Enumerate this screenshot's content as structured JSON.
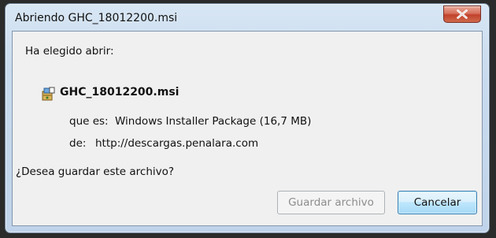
{
  "window": {
    "title": "Abriendo GHC_18012200.msi",
    "close_icon": "close-icon"
  },
  "content": {
    "intro": "Ha elegido abrir:",
    "file_icon": "installer-package-icon",
    "filename": "GHC_18012200.msi",
    "type_label": "que es:",
    "type_value": "Windows Installer Package (16,7 MB)",
    "from_label": "de:",
    "from_value": "http://descargas.penalara.com",
    "question": "¿Desea guardar este archivo?"
  },
  "buttons": {
    "save_label": "Guardar archivo",
    "cancel_label": "Cancelar"
  },
  "colors": {
    "close_button": "#c7432e",
    "frame": "#c9dbee",
    "client": "#f0f0f0",
    "focus_border": "#3c7fb1"
  }
}
